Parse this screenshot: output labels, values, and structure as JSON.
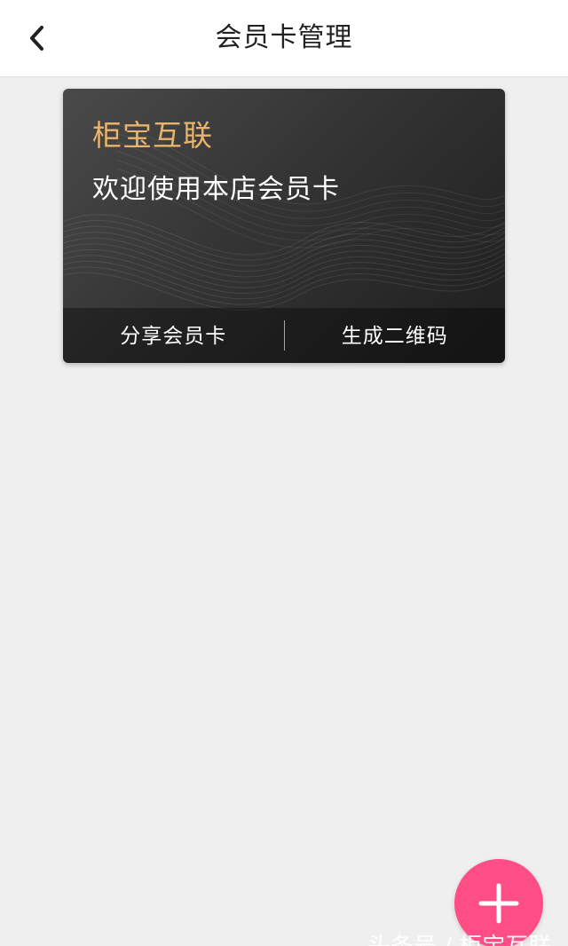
{
  "header": {
    "title": "会员卡管理",
    "back_icon": "chevron-left-icon"
  },
  "card": {
    "brand_name": "柜宝互联",
    "welcome_text": "欢迎使用本店会员卡",
    "share_label": "分享会员卡",
    "qrcode_label": "生成二维码",
    "brand_color": "#e9b46b"
  },
  "fab": {
    "icon": "plus-icon",
    "color": "#ff4d86"
  },
  "watermark": {
    "text": "头条号 / 柜宝互联"
  }
}
